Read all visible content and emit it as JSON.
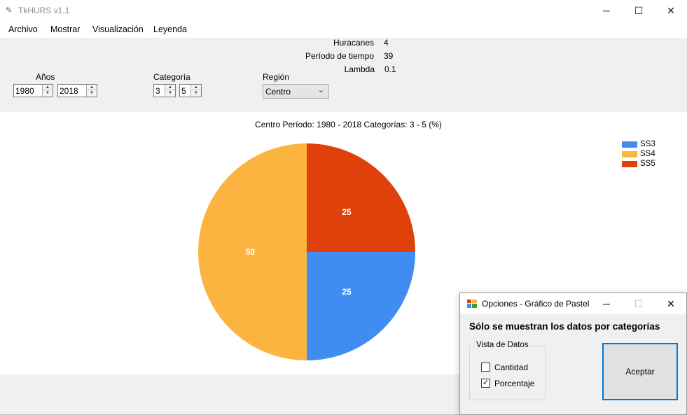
{
  "window": {
    "title": "TkHURS v1.1",
    "minimize_glyph": "─",
    "maximize_glyph": "☐",
    "close_glyph": "✕"
  },
  "menu": {
    "items": [
      "Archivo",
      "Mostrar",
      "Visualización",
      "Leyenda"
    ]
  },
  "stats": {
    "huracanes_label": "Huracanes",
    "huracanes_value": "4",
    "periodo_label": "Período de tiempo",
    "periodo_value": "39",
    "lambda_label": "Lambda",
    "lambda_value": "0.1"
  },
  "filters": {
    "anos_label": "Años",
    "year_from": "1980",
    "year_to": "2018",
    "categoria_label": "Categoría",
    "cat_from": "3",
    "cat_to": "5",
    "region_label": "Región",
    "region_value": "Centro"
  },
  "chart_data": {
    "type": "pie",
    "title": "Centro Período: 1980 - 2018 Categorías: 3 - 5 (%)",
    "categories": [
      "SS3",
      "SS4",
      "SS5"
    ],
    "values": [
      25,
      50,
      25
    ],
    "colors": [
      "#418cf0",
      "#fcb441",
      "#e0400a"
    ],
    "legend_position": "top-right",
    "data_labels": [
      "25",
      "50",
      "25"
    ]
  },
  "dialog": {
    "title": "Opciones - Gráfico de Pastel",
    "heading": "Sólo se muestran los datos por categorías",
    "group_label": "Vista de Datos",
    "cantidad_label": "Cantidad",
    "cantidad_checked": false,
    "porcentaje_label": "Porcentaje",
    "porcentaje_checked": true,
    "ok_label": "Aceptar",
    "minimize_glyph": "─",
    "maximize_glyph": "☐",
    "close_glyph": "✕"
  }
}
